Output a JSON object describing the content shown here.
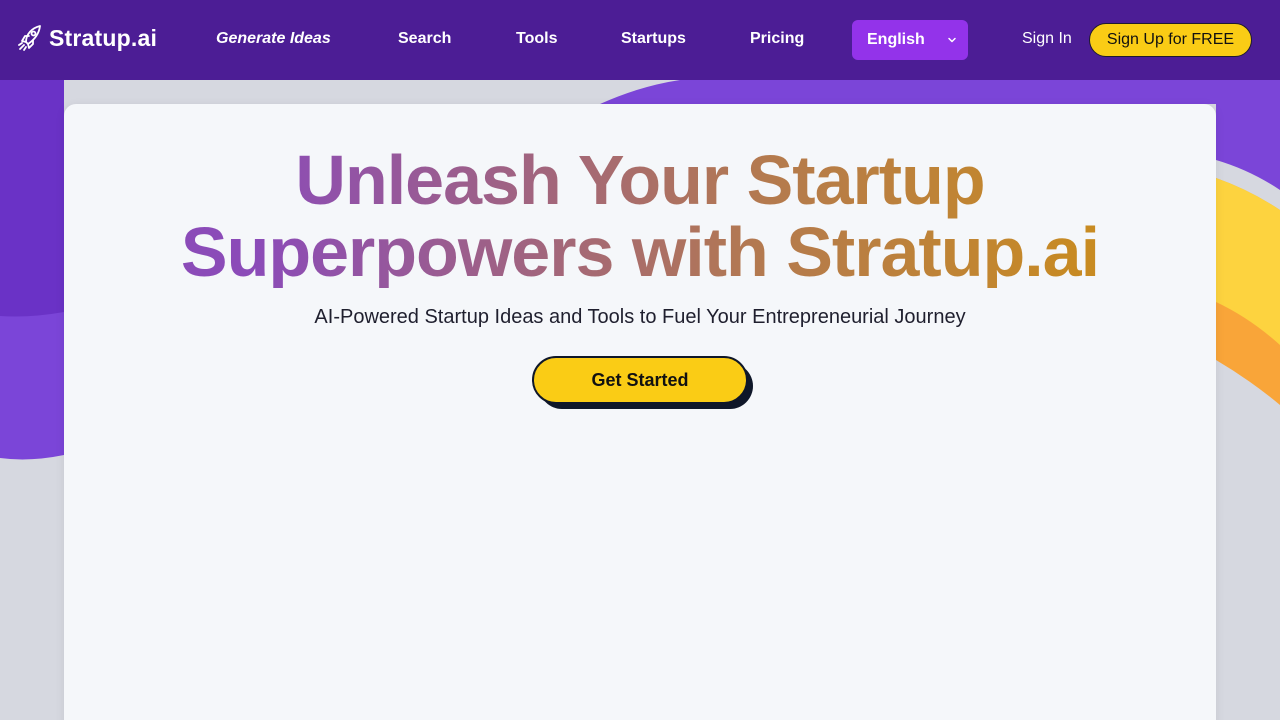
{
  "colors": {
    "navbar": "#4c1d95",
    "language_button": "#9333ea",
    "cta": "#facc15",
    "card": "#f5f7fa",
    "page_background": "#d6d8e0"
  },
  "navbar": {
    "brand": {
      "name": "Stratup.ai",
      "icon": "rocket-icon"
    },
    "links": [
      {
        "label": "Generate Ideas"
      },
      {
        "label": "Search"
      },
      {
        "label": "Tools"
      },
      {
        "label": "Startups"
      },
      {
        "label": "Pricing"
      }
    ],
    "language": {
      "selected": "English",
      "icon": "chevron-down-icon"
    },
    "sign_in": "Sign In",
    "sign_up": "Sign Up for FREE"
  },
  "hero": {
    "title_line1": "Unleash Your Startup",
    "title_line2": "Superpowers with Stratup.ai",
    "subtitle": "AI-Powered Startup Ideas and Tools to Fuel Your Entrepreneurial Journey",
    "cta": "Get Started"
  }
}
